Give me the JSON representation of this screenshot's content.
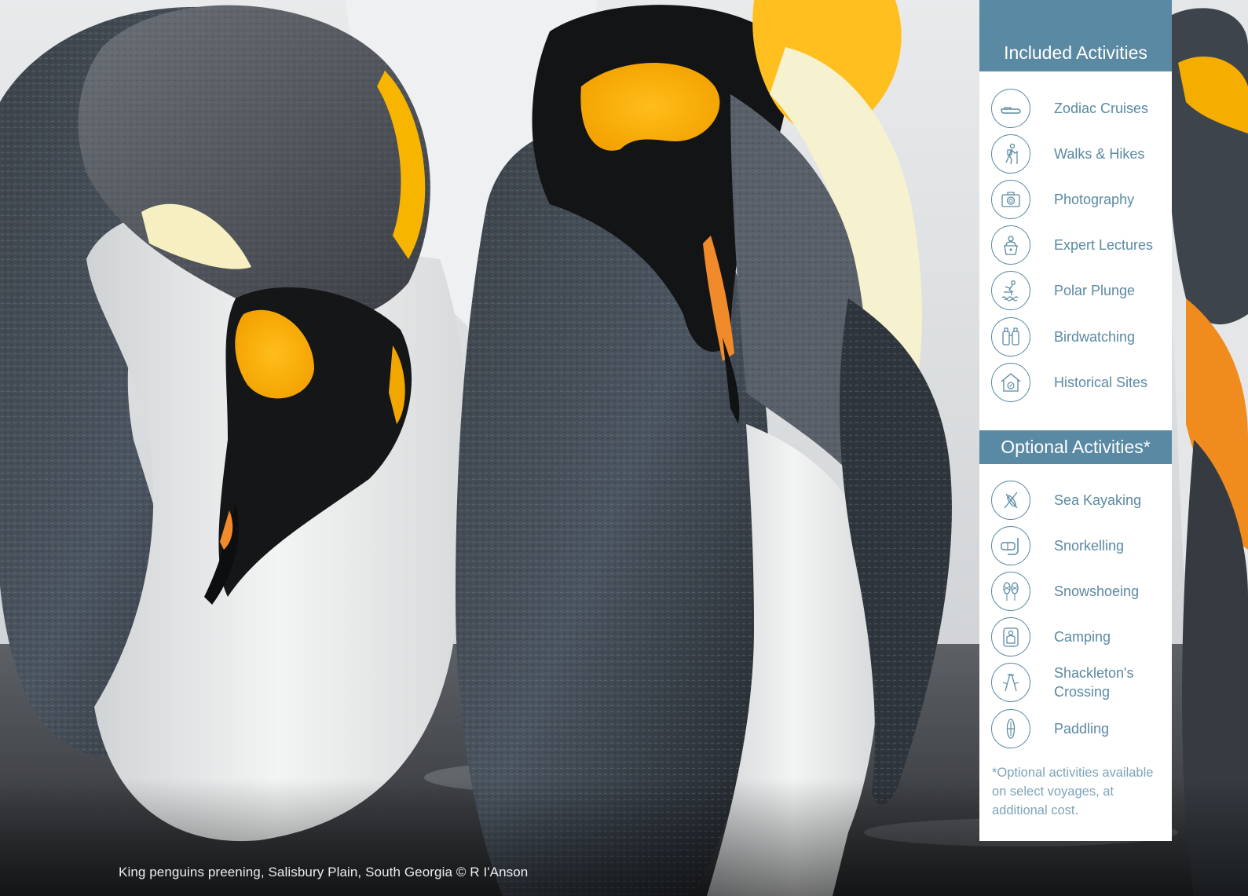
{
  "caption": "King penguins preening, Salisbury Plain, South Georgia © R I'Anson",
  "colors": {
    "accent": "#5a89a3",
    "panel_bg": "#ffffff",
    "footnote": "#7ea3b8"
  },
  "included": {
    "title": "Included Activities",
    "items": [
      {
        "label": "Zodiac Cruises",
        "icon": "zodiac-boat-icon"
      },
      {
        "label": "Walks & Hikes",
        "icon": "hiker-icon"
      },
      {
        "label": "Photography",
        "icon": "camera-icon"
      },
      {
        "label": "Expert Lectures",
        "icon": "lecturer-podium-icon"
      },
      {
        "label": "Polar Plunge",
        "icon": "diver-plunge-icon"
      },
      {
        "label": "Birdwatching",
        "icon": "binoculars-icon"
      },
      {
        "label": "Historical Sites",
        "icon": "historic-hut-icon"
      }
    ]
  },
  "optional": {
    "title": "Optional Activities*",
    "items": [
      {
        "label": "Sea Kayaking",
        "icon": "kayak-icon"
      },
      {
        "label": "Snorkelling",
        "icon": "snorkel-mask-icon"
      },
      {
        "label": "Snowshoeing",
        "icon": "snowshoes-icon"
      },
      {
        "label": "Camping",
        "icon": "sleeping-bag-icon"
      },
      {
        "label": "Shackleton's Crossing",
        "icon": "ice-axe-icon"
      },
      {
        "label": "Paddling",
        "icon": "paddle-board-icon"
      }
    ],
    "footnote": "*Optional activities available on select voyages, at additional cost."
  }
}
